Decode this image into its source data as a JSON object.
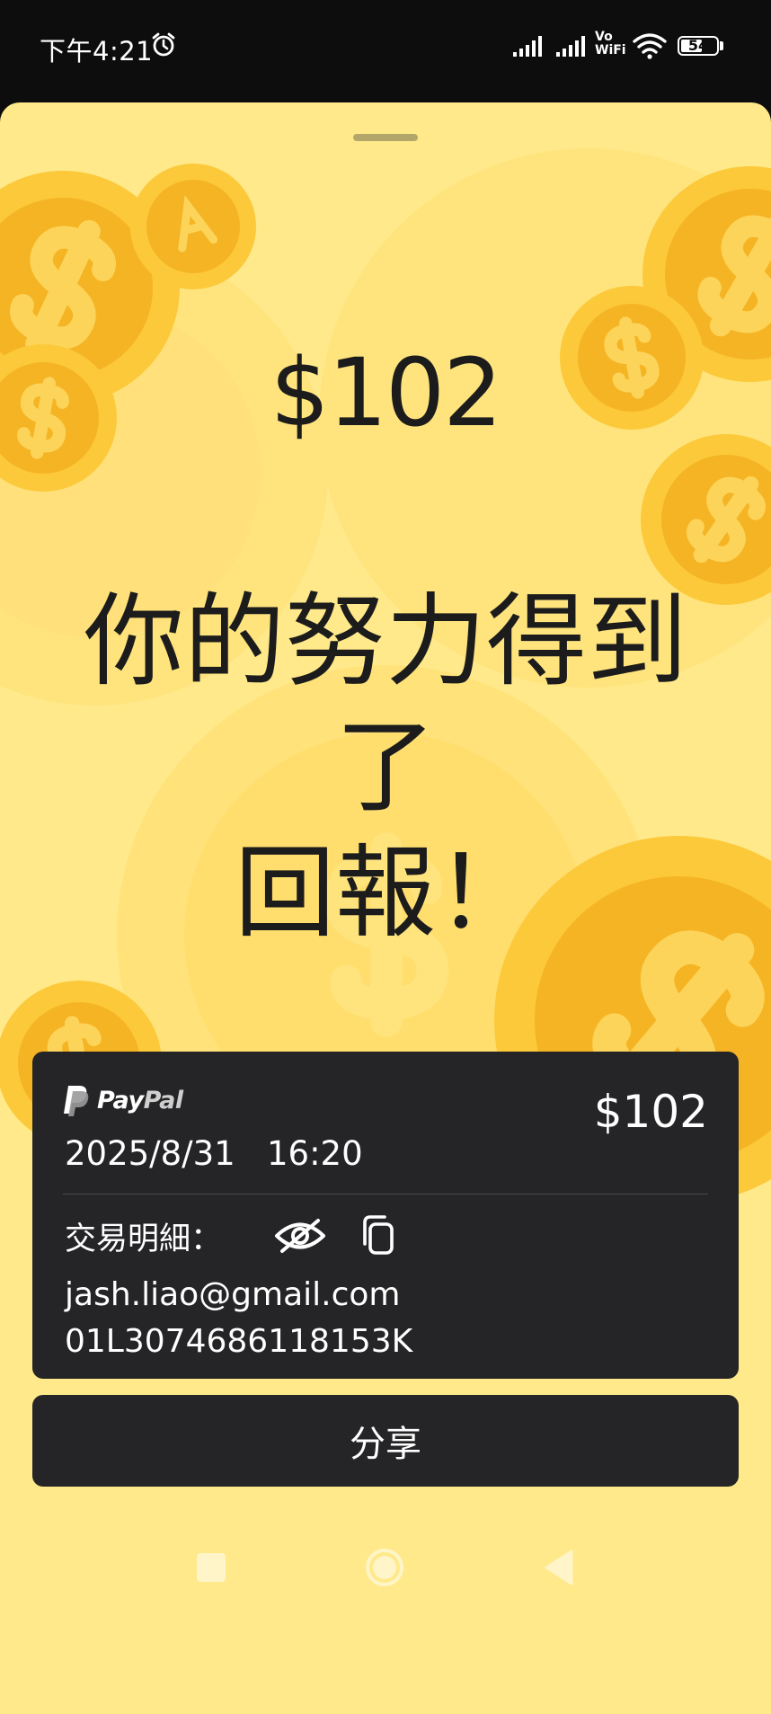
{
  "status_bar": {
    "time": "下午4:21",
    "vowifi_line1": "Vo",
    "vowifi_line2": "WiFi",
    "battery_level": "54"
  },
  "hero": {
    "amount": "$102",
    "headline_line1": "你的努力得到了",
    "headline_line2": "回報！"
  },
  "card": {
    "brand_pay": "Pay",
    "brand_pal": "Pal",
    "amount": "$102",
    "datetime": "2025/8/31   16:20",
    "details_label": "交易明細：",
    "email": "jash.liao@gmail.com",
    "transaction_id": "01L3074686118153K"
  },
  "share": {
    "label": "分享"
  },
  "colors": {
    "background": "#ffe98a",
    "card": "#252527",
    "coin": "#f7b92a",
    "coin_rim": "#fcd045"
  },
  "icons": [
    "alarm-icon",
    "cellular-signal-icon",
    "wifi-icon",
    "battery-icon",
    "paypal-icon",
    "eye-off-icon",
    "copy-icon",
    "nav-recents-icon",
    "nav-home-icon",
    "nav-back-icon"
  ]
}
